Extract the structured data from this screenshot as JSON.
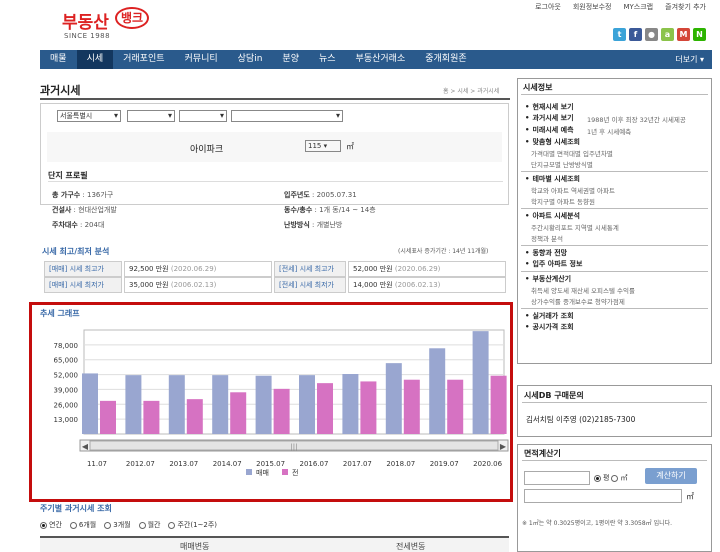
{
  "logo": {
    "main": "부동산",
    "bank": "뱅크",
    "since": "SINCE 1988"
  },
  "toplinks": [
    "로그아웃",
    "회원정보수정",
    "MY스크랩",
    "즐겨찾기 추가"
  ],
  "nav": {
    "items": [
      "매물",
      "시세",
      "거래포인트",
      "커뮤니티",
      "상담in",
      "분양",
      "뉴스",
      "부동산거래소",
      "중개회원존"
    ],
    "active": 1,
    "more": "더보기 ▾"
  },
  "page": {
    "title": "과거시세",
    "breadcrumb": "홈 > 시세 > 과거시세"
  },
  "search": {
    "selects": [
      "서울특별시",
      "",
      "",
      ""
    ],
    "apt_name": "아이파크",
    "size": "115",
    "unit": "㎡"
  },
  "profile": {
    "heading": "단지 프로필",
    "items": [
      {
        "k": "총 가구수",
        "v": "136가구"
      },
      {
        "k": "입주년도",
        "v": "2005.07.31"
      },
      {
        "k": "건설사",
        "v": "현대산업개발"
      },
      {
        "k": "동수/총수",
        "v": "1개 동/14 ~ 14층"
      },
      {
        "k": "주차대수",
        "v": "204대"
      },
      {
        "k": "난방방식",
        "v": "개별난방"
      }
    ]
  },
  "trade": {
    "heading": "시세 최고/최저 분석",
    "note": "(시세표사 증가기간 : 14년 11개월)",
    "rows": [
      [
        {
          "label": "[매매] 시세 최고가",
          "value": "92,500 만원",
          "date": "(2020.06.29)"
        },
        {
          "label": "[전세] 시세 최고가",
          "value": "52,000 만원",
          "date": "(2020.06.29)"
        }
      ],
      [
        {
          "label": "[매매] 시세 최저가",
          "value": "35,000 만원",
          "date": "(2006.02.13)"
        },
        {
          "label": "[전세] 시세 최저가",
          "value": "14,000 만원",
          "date": "(2006.02.13)"
        }
      ]
    ]
  },
  "chart_title": "추세 그래프",
  "chart_data": {
    "type": "bar",
    "categories": [
      "2011.07",
      "2012.07",
      "2013.07",
      "2014.07",
      "2015.07",
      "2016.07",
      "2017.07",
      "2018.07",
      "2019.07",
      "2020.06"
    ],
    "category_labels": [
      "11.07",
      "2012.07",
      "2013.07",
      "2014.07",
      "2015.07",
      "2016.07",
      "2017.07",
      "2018.07",
      "2019.07",
      "2020.06"
    ],
    "series": [
      {
        "name": "매매",
        "color": "#99a6d0",
        "values": [
          53000,
          51500,
          51500,
          51500,
          51000,
          51500,
          52500,
          62000,
          75000,
          90000
        ]
      },
      {
        "name": "전",
        "color": "#d672c2",
        "values": [
          29000,
          29000,
          30500,
          36500,
          39500,
          44500,
          46000,
          47500,
          47500,
          51000
        ]
      }
    ],
    "yticks": [
      "13,000",
      "26,000",
      "39,000",
      "52,000",
      "65,000",
      "78,000"
    ],
    "ylim": [
      0,
      91000
    ],
    "legend": "bottom-center",
    "grid": true
  },
  "bottom": {
    "heading": "주기별 과거시세 조회",
    "radios": [
      "연간",
      "6개월",
      "3개월",
      "월간",
      "주간(1~2주)"
    ],
    "selected": 0,
    "cols": [
      "매매변동",
      "전세변동"
    ]
  },
  "sidebar": {
    "title": "시세정보",
    "groups": [
      {
        "head": "현재시세 보기",
        "sub": ""
      },
      {
        "head": "과거시세 보기",
        "sub": "1988년 이후 최장 32년간 시세제공"
      },
      {
        "head": "미래시세 예측",
        "sub": "1년 후 시세예측"
      },
      {
        "head": "맞춤형 시세조회",
        "sub": "가격대별   면적대별   입주년차별"
      },
      {
        "head": "",
        "sub": "단지규모별   난방방식별"
      },
      {
        "head": "테마별 시세조회",
        "sub": "학교와 아파트   역세권별 아파트"
      },
      {
        "head": "",
        "sub": "학지구별 아파트   동향원"
      },
      {
        "head": "아파트 시세분석",
        "sub": "주간시황리포트   지역별 시세통계"
      },
      {
        "head": "",
        "sub": "정책과 분석"
      },
      {
        "head": "동향과 전망",
        "sub": ""
      },
      {
        "head": "입주 아파트 정보",
        "sub": ""
      },
      {
        "head": "부동산계산기",
        "sub": "취득세   양도세   재산세   오피스텔 수익률"
      },
      {
        "head": "",
        "sub": "상가수익률   중개보수료   청약가점제"
      },
      {
        "head": "실거래가 조회",
        "sub": ""
      },
      {
        "head": "공시가격 조회",
        "sub": ""
      }
    ]
  },
  "db": {
    "title": "시세DB 구매문의",
    "contact": "김서치팀 이주영 (02)2185-7300"
  },
  "calc": {
    "title": "면적계산기",
    "unit1": "평",
    "unit2": "㎡",
    "button": "계산하기",
    "unit3": "㎡",
    "note": "※ 1㎡는 약 0.3025평이고, 1평이란 약 3.3058㎡ 입니다."
  }
}
